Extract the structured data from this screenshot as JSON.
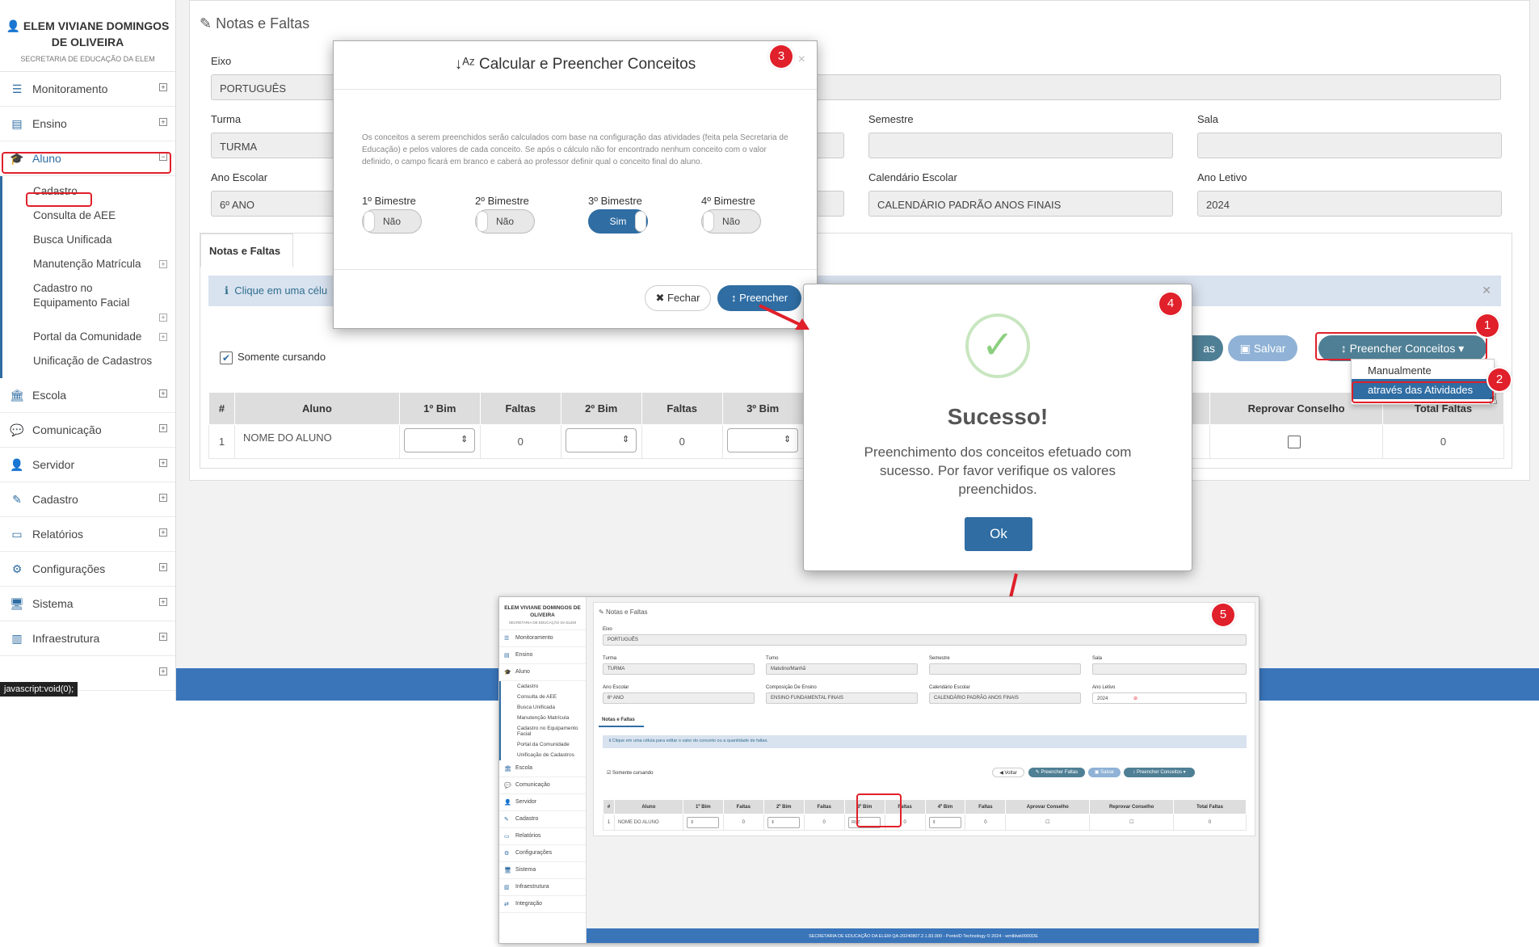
{
  "sidebar": {
    "user_name": "ELEM VIVIANE DOMINGOS DE OLIVEIRA",
    "user_sub": "SECRETARIA DE EDUCAÇÃO DA ELEM",
    "items_top": [
      {
        "label": "Monitoramento",
        "icon": "sliders-icon"
      },
      {
        "label": "Ensino",
        "icon": "book-icon"
      },
      {
        "label": "Aluno",
        "icon": "graduation-cap-icon"
      }
    ],
    "aluno_sub": [
      "Cadastro",
      "Consulta de AEE",
      "Busca Unificada",
      "Manutenção Matrícula",
      "Cadastro no Equipamento Facial",
      "Portal da Comunidade",
      "Unificação de Cadastros"
    ],
    "items_bottom": [
      {
        "label": "Escola",
        "icon": "bank-icon"
      },
      {
        "label": "Comunicação",
        "icon": "chat-icon"
      },
      {
        "label": "Servidor",
        "icon": "user-icon"
      },
      {
        "label": "Cadastro",
        "icon": "edit-icon"
      },
      {
        "label": "Relatórios",
        "icon": "document-icon"
      },
      {
        "label": "Configurações",
        "icon": "gear-icon"
      },
      {
        "label": "Sistema",
        "icon": "monitor-icon"
      },
      {
        "label": "Infraestrutura",
        "icon": "building-icon"
      }
    ],
    "tooltip": "javascript:void(0);"
  },
  "page": {
    "title": "Notas e Faltas",
    "fields": {
      "eixo_label": "Eixo",
      "eixo_value": "PORTUGUÊS",
      "turma_label": "Turma",
      "turma_value": "TURMA",
      "semestre_label": "Semestre",
      "semestre_value": "",
      "sala_label": "Sala",
      "sala_value": "",
      "ano_escolar_label": "Ano Escolar",
      "ano_escolar_value": "6º ANO",
      "calendario_label": "Calendário Escolar",
      "calendario_value": "CALENDÁRIO PADRÃO ANOS FINAIS",
      "ano_letivo_label": "Ano Letivo",
      "ano_letivo_value": "2024"
    },
    "tab": "Notas e Faltas",
    "info": "Clique em uma célu",
    "somente_cursando": "Somente cursando",
    "buttons": {
      "faltas_partial": "as",
      "salvar": "Salvar",
      "preencher": "Preencher Conceitos"
    },
    "dropdown": [
      "Manualmente",
      "através das Atividades"
    ],
    "table": {
      "headers": [
        "#",
        "Aluno",
        "1º Bim",
        "Faltas",
        "2º Bim",
        "Faltas",
        "3º Bim",
        "Reprovar Conselho",
        "Total Faltas"
      ],
      "row": {
        "num": "1",
        "aluno": "NOME DO ALUNO",
        "faltas1": "0",
        "faltas2": "0",
        "total": "0"
      }
    }
  },
  "modal_calc": {
    "title": "Calcular e Preencher Conceitos",
    "text": "Os conceitos a serem preenchidos serão calculados com base na configuração das atividades (feita pela Secretaria de Educação) e pelos valores de cada conceito. Se após o cálculo não for encontrado nenhum conceito com o valor definido, o campo ficará em branco e caberá ao professor definir qual o conceito final do aluno.",
    "bimestres": [
      {
        "label": "1º Bimestre",
        "value": "Não",
        "on": false
      },
      {
        "label": "2º Bimestre",
        "value": "Não",
        "on": false
      },
      {
        "label": "3º Bimestre",
        "value": "Sim",
        "on": true
      },
      {
        "label": "4º Bimestre",
        "value": "Não",
        "on": false
      }
    ],
    "close": "Fechar",
    "fill": "Preencher"
  },
  "modal_success": {
    "title": "Sucesso!",
    "text": "Preenchimento dos conceitos efetuado com sucesso. Por favor verifique os valores preenchidos.",
    "ok": "Ok"
  },
  "badges": [
    "1",
    "2",
    "3",
    "4",
    "5"
  ],
  "thumb": {
    "user_name": "ELEM VIVIANE DOMINGOS DE OLIVEIRA",
    "user_sub": "SECRETARIA DE EDUCAÇÃO DA ELEM",
    "nav": [
      "Monitoramento",
      "Ensino",
      "Aluno"
    ],
    "sub": [
      "Cadastro",
      "Consulta de AEE",
      "Busca Unificada",
      "Manutenção Matrícula",
      "Cadastro no Equipamento Facial",
      "Portal da Comunidade",
      "Unificação de Cadastros"
    ],
    "nav2": [
      "Escola",
      "Comunicação",
      "Servidor",
      "Cadastro",
      "Relatórios",
      "Configurações",
      "Sistema",
      "Infraestrutura",
      "Integração"
    ],
    "title": "Notas e Faltas",
    "eixo_label": "Eixo",
    "eixo": "PORTUGUÊS",
    "turma_label": "Turma",
    "turma": "TURMA",
    "turno_label": "Turno",
    "turno": "Matutino/Manhã",
    "semestre_label": "Semestre",
    "sala_label": "Sala",
    "ano_escolar_label": "Ano Escolar",
    "ano_escolar": "6º ANO",
    "comp_label": "Composição De Ensino",
    "comp": "ENSINO FUNDAMENTAL FINAIS",
    "cal_label": "Calendário Escolar",
    "cal": "CALENDÁRIO PADRÃO ANOS FINAIS",
    "ano_letivo_label": "Ano Letivo",
    "ano_letivo": "2024",
    "tab": "Notas e Faltas",
    "info": "Clique em uma célula para editar o valor do conceito ou a quantidade de faltas.",
    "somente": "Somente cursando",
    "voltar": "Voltar",
    "pfaltas": "Preencher Faltas",
    "salvar": "Salvar",
    "pconceitos": "Preencher Conceitos",
    "headers": [
      "#",
      "Aluno",
      "1º Bim",
      "Faltas",
      "2º Bim",
      "Faltas",
      "3º Bim",
      "Faltas",
      "4º Bim",
      "Faltas",
      "Aprovar Conselho",
      "Reprovar Conselho",
      "Total Faltas"
    ],
    "row": [
      "1",
      "NOME DO ALUNO",
      "0",
      "0",
      "RLZ",
      "0",
      "0",
      "0"
    ],
    "footer": "SECRETARIA DE EDUCAÇÃO DA ELEM QA-20240807.2.1.83.000 - PontoID Technology © 2024 - wmlldwk0000DE"
  },
  "colors": {
    "primary": "#2f6da3",
    "dark_btn": "#4f7f95",
    "red": "#e0202a",
    "footer": "#3a75ba"
  }
}
